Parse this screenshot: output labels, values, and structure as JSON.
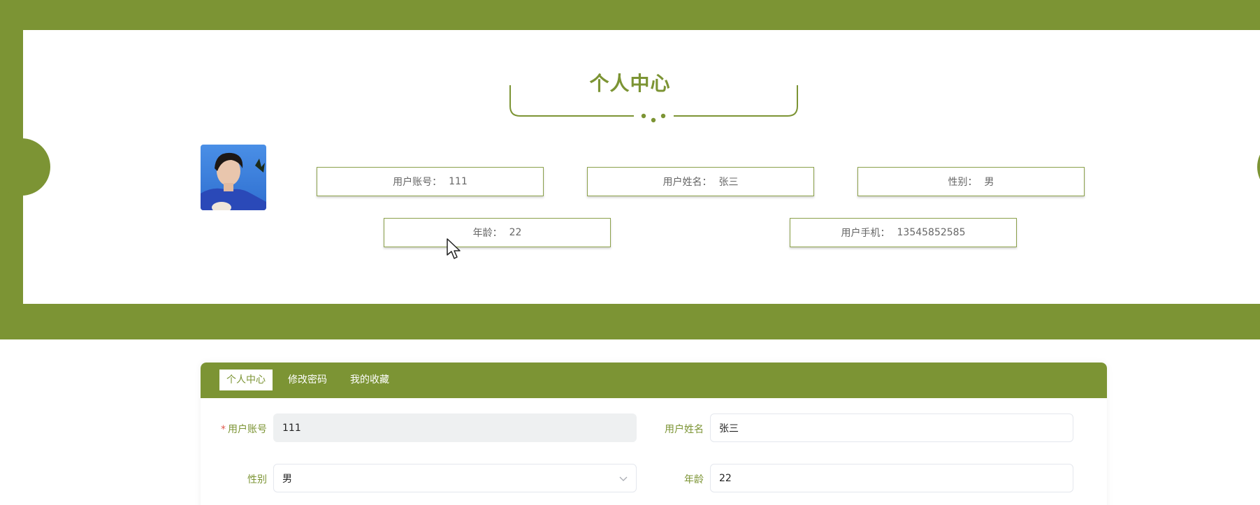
{
  "page": {
    "title": "个人中心"
  },
  "colors": {
    "primary": "#7c9434",
    "required": "#e05a4e"
  },
  "profile": {
    "avatar_icon": "user-photo",
    "fields": [
      {
        "label": "用户账号：",
        "value": "111"
      },
      {
        "label": "用户姓名：",
        "value": "张三"
      },
      {
        "label": "性别：",
        "value": "男"
      },
      {
        "label": "年龄：",
        "value": "22"
      },
      {
        "label": "用户手机：",
        "value": "13545852585"
      }
    ]
  },
  "tabs": [
    {
      "label": "个人中心",
      "active": true
    },
    {
      "label": "修改密码",
      "active": false
    },
    {
      "label": "我的收藏",
      "active": false
    }
  ],
  "form": {
    "account": {
      "label": "用户账号",
      "value": "111",
      "required_mark": "*"
    },
    "name": {
      "label": "用户姓名",
      "value": "张三"
    },
    "gender": {
      "label": "性别",
      "value": "男"
    },
    "age": {
      "label": "年龄",
      "value": "22"
    }
  }
}
